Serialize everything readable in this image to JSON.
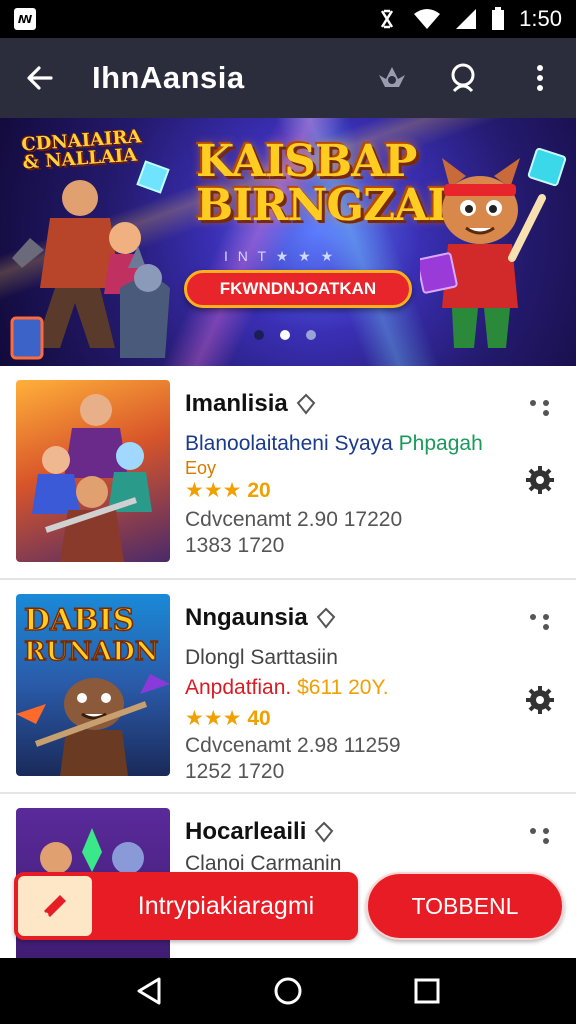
{
  "status_bar": {
    "app_badge": "ꟿ",
    "time": "1:50"
  },
  "app_bar": {
    "title": "IhnAansia"
  },
  "banner": {
    "logo_text": "CDNAIAIRA & NALLAIA",
    "headline": "KAISBAP BIRNGZAI",
    "subline": "I N T ★ ★ ★",
    "cta_label": "FKWNDNJOATKAN",
    "page_indicator": "2 / 3"
  },
  "games": [
    {
      "name": "Imanlisia",
      "line1": "Blanoolaitaheni Syaya",
      "line1_accent": "Phpagah",
      "line2": "Eoy",
      "stars": "★★★",
      "rating": "20",
      "meta": "Cdvcenamt 2.90 17220",
      "meta2": "1383 1720"
    },
    {
      "name": "Nngaunsia",
      "line1": "Dlongl Sarttasiin",
      "line2": "Anpdatfian.",
      "line2_accent": "$611 20Y.",
      "stars": "★★★",
      "rating": "40",
      "meta": "Cdvcenamt 2.98 11259",
      "meta2": "1252 1720"
    },
    {
      "name": "Hocarleaili",
      "line1": "Clanoi Carmanin"
    }
  ],
  "buttons": {
    "primary_label": "Intrypiakiaragmi",
    "secondary_label": "TOBBENL"
  },
  "colors": {
    "accent": "#e81c24",
    "app_bar": "#2b2d3d",
    "star": "#f0a000"
  }
}
